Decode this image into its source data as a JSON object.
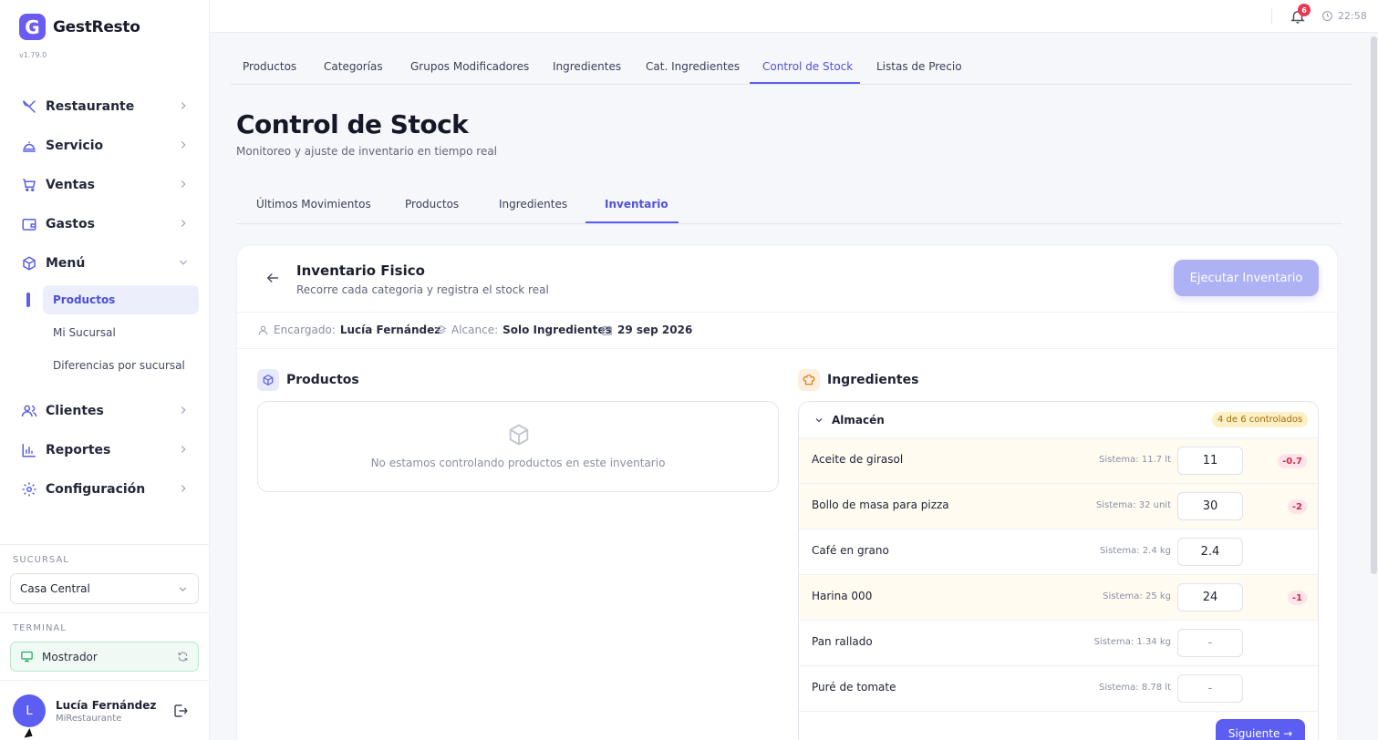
{
  "app": {
    "logo_letter": "G",
    "name": "GestResto",
    "version": "v1.79.0"
  },
  "sidebar": {
    "items": [
      {
        "label": "Restaurante",
        "icon": "utensils-icon"
      },
      {
        "label": "Servicio",
        "icon": "cloche-icon"
      },
      {
        "label": "Ventas",
        "icon": "cart-icon"
      },
      {
        "label": "Gastos",
        "icon": "wallet-icon"
      },
      {
        "label": "Menú",
        "icon": "cube-icon",
        "expanded": true
      },
      {
        "label": "Clientes",
        "icon": "users-icon"
      },
      {
        "label": "Reportes",
        "icon": "bar-chart-icon"
      },
      {
        "label": "Configuración",
        "icon": "gear-icon"
      }
    ],
    "menu_sub": [
      "Productos",
      "Mi Sucursal",
      "Diferencias por sucursal"
    ],
    "branch_caption": "SUCURSAL",
    "branch_value": "Casa Central",
    "terminal_caption": "TERMINAL",
    "terminal_value": "Mostrador",
    "user": {
      "initial": "L",
      "name": "Lucía Fernández",
      "org": "MiRestaurante"
    }
  },
  "topbar": {
    "notifications": "6",
    "time": "22:58"
  },
  "main_tabs": [
    "Productos",
    "Categorías",
    "Grupos Modificadores",
    "Ingredientes",
    "Cat. Ingredientes",
    "Control de Stock",
    "Listas de Precio"
  ],
  "page": {
    "title": "Control de Stock",
    "subtitle": "Monitoreo y ajuste de inventario en tiempo real"
  },
  "sub_tabs": [
    "Últimos Movimientos",
    "Productos",
    "Ingredientes",
    "Inventario"
  ],
  "inventory": {
    "title": "Inventario Fisico",
    "subtitle": "Recorre cada categoria y registra el stock real",
    "execute_label": "Ejecutar Inventario",
    "manager_label": "Encargado:",
    "manager_value": "Lucía Fernández",
    "scope_label": "Alcance:",
    "scope_value": "Solo Ingredientes",
    "date": "29 sep 2026",
    "products_title": "Productos",
    "products_empty": "No estamos controlando productos en este inventario",
    "ingredients_title": "Ingredientes",
    "group_name": "Almacén",
    "group_badge": "4 de 6 controlados",
    "rows": [
      {
        "name": "Aceite de girasol",
        "system": "Sistema: 11.7 lt",
        "value": "11",
        "diff": "-0.7"
      },
      {
        "name": "Bollo de masa para pizza",
        "system": "Sistema: 32 unit",
        "value": "30",
        "diff": "-2"
      },
      {
        "name": "Café en grano",
        "system": "Sistema: 2.4 kg",
        "value": "2.4",
        "diff": ""
      },
      {
        "name": "Harina 000",
        "system": "Sistema: 25 kg",
        "value": "24",
        "diff": "-1"
      },
      {
        "name": "Pan rallado",
        "system": "Sistema: 1.34 kg",
        "value": "-",
        "diff": ""
      },
      {
        "name": "Puré de tomate",
        "system": "Sistema: 8.78 lt",
        "value": "-",
        "diff": ""
      }
    ],
    "next_label": "Siguiente →"
  }
}
